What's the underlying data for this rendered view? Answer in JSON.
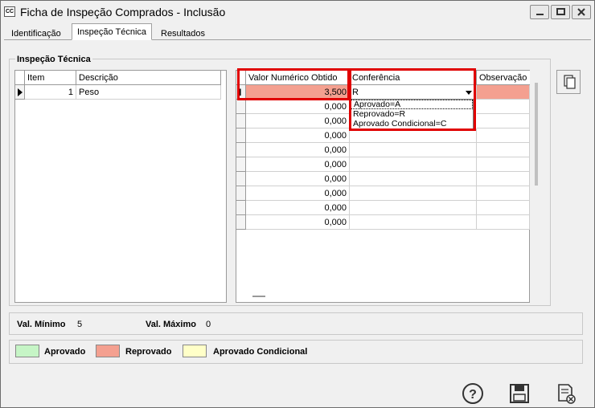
{
  "window": {
    "title": "Ficha de Inspeção Comprados - Inclusão",
    "icon_text": "CC"
  },
  "tabs": [
    {
      "label": "Identificação"
    },
    {
      "label": "Inspeção Técnica",
      "active": true
    },
    {
      "label": "Resultados"
    }
  ],
  "group_title": "Inspeção Técnica",
  "items_grid": {
    "headers": [
      "Item",
      "Descrição"
    ],
    "rows": [
      {
        "item": "1",
        "descricao": "Peso"
      }
    ]
  },
  "values_grid": {
    "headers": [
      "Valor Numérico Obtido",
      "Conferência",
      "Observação"
    ],
    "rows": [
      {
        "valor": "3,500",
        "conferencia": "R"
      },
      {
        "valor": "0,000",
        "conferencia": ""
      },
      {
        "valor": "0,000",
        "conferencia": ""
      },
      {
        "valor": "0,000",
        "conferencia": ""
      },
      {
        "valor": "0,000",
        "conferencia": ""
      },
      {
        "valor": "0,000",
        "conferencia": ""
      },
      {
        "valor": "0,000",
        "conferencia": ""
      },
      {
        "valor": "0,000",
        "conferencia": ""
      },
      {
        "valor": "0,000",
        "conferencia": ""
      },
      {
        "valor": "0,000",
        "conferencia": ""
      }
    ]
  },
  "dropdown_options": [
    "Aprovado=A",
    "Reprovado=R",
    "Aprovado Condicional=C"
  ],
  "limits": {
    "min_label": "Val. Mínimo",
    "min_value": "5",
    "max_label": "Val. Máximo",
    "max_value": "0"
  },
  "legend": [
    {
      "label": "Aprovado",
      "color": "#c6f5c6"
    },
    {
      "label": "Reprovado",
      "color": "#f4a090"
    },
    {
      "label": "Aprovado Condicional",
      "color": "#ffffc8"
    }
  ],
  "colors": {
    "highlight_red": "#e00000",
    "selected_row": "#f4a090"
  }
}
